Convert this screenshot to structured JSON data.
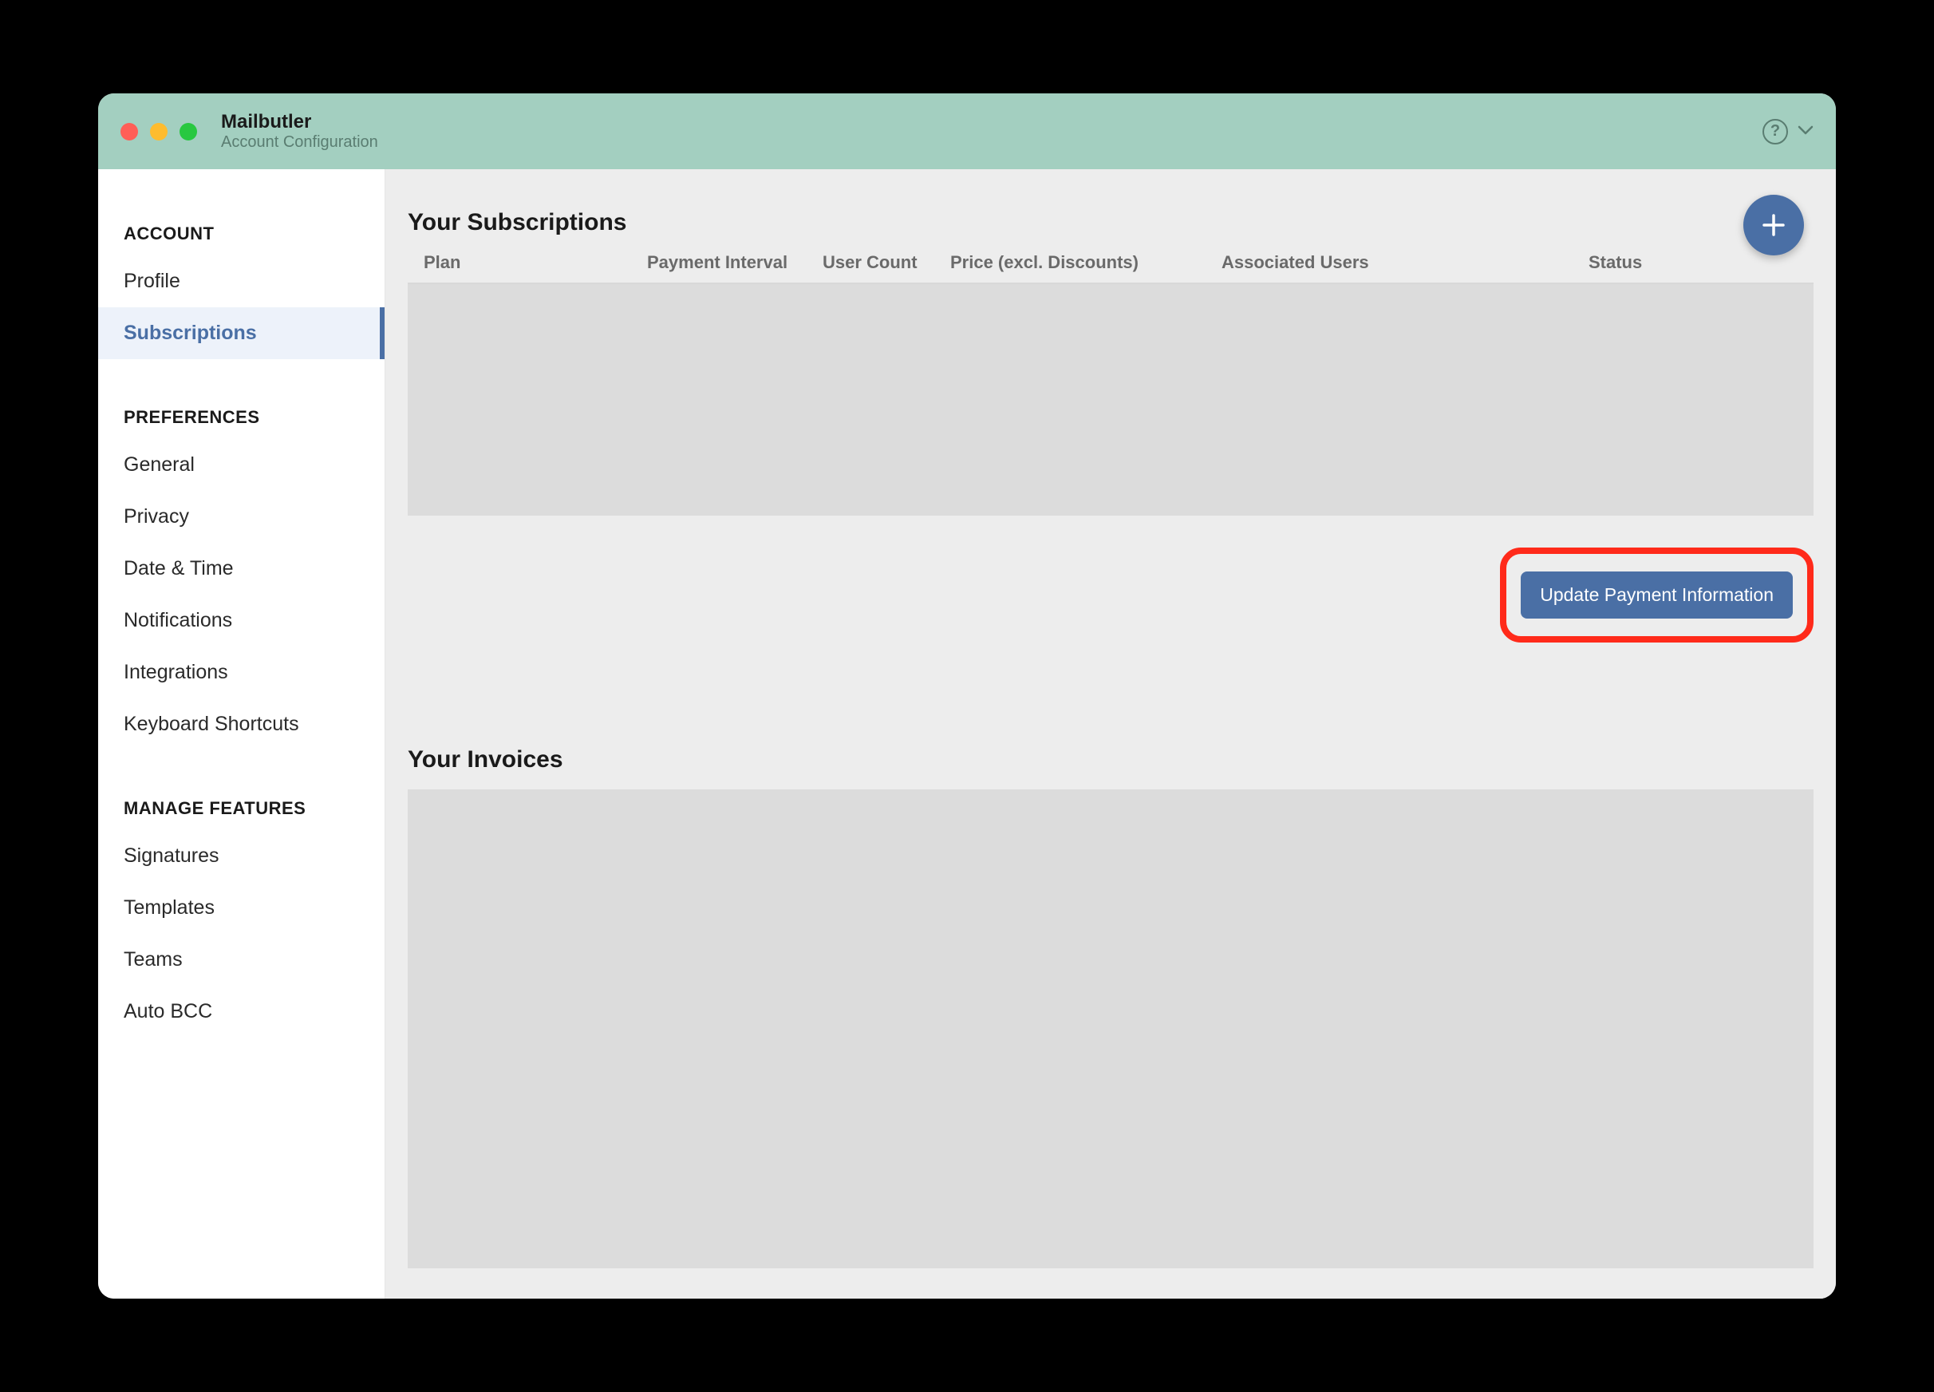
{
  "titlebar": {
    "app_name": "Mailbutler",
    "subtitle": "Account Configuration"
  },
  "sidebar": {
    "sections": [
      {
        "header": "ACCOUNT",
        "items": [
          "Profile",
          "Subscriptions"
        ]
      },
      {
        "header": "PREFERENCES",
        "items": [
          "General",
          "Privacy",
          "Date & Time",
          "Notifications",
          "Integrations",
          "Keyboard Shortcuts"
        ]
      },
      {
        "header": "MANAGE FEATURES",
        "items": [
          "Signatures",
          "Templates",
          "Teams",
          "Auto BCC"
        ]
      }
    ],
    "active_item": "Subscriptions"
  },
  "main": {
    "subscriptions_title": "Your Subscriptions",
    "columns": {
      "plan": "Plan",
      "interval": "Payment Interval",
      "count": "User Count",
      "price": "Price (excl. Discounts)",
      "users": "Associated Users",
      "status": "Status"
    },
    "update_button": "Update Payment Information",
    "invoices_title": "Your Invoices"
  }
}
